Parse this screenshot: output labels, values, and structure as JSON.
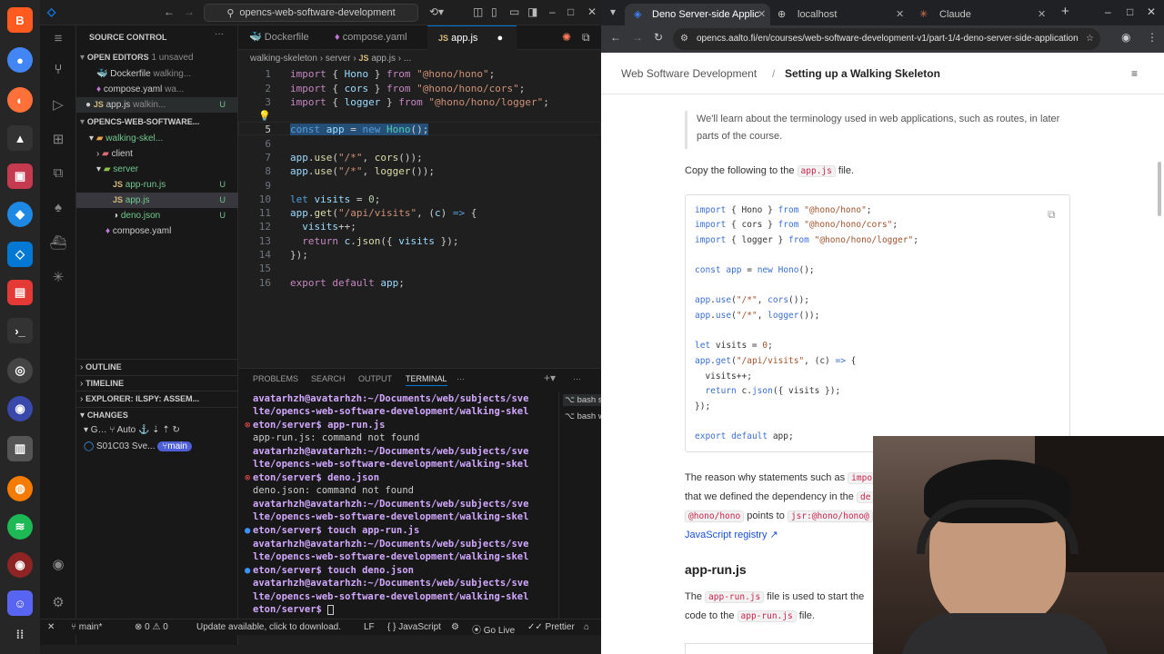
{
  "window": {
    "command_center": "opencs-web-software-development"
  },
  "sidebar": {
    "title": "SOURCE CONTROL",
    "open_editors": "OPEN EDITORS",
    "unsaved": "1 unsaved",
    "open_files": [
      {
        "name": "Dockerfile",
        "path": "walking...",
        "badge": ""
      },
      {
        "name": "compose.yaml",
        "path": "wa...",
        "badge": ""
      },
      {
        "name": "app.js",
        "path": "walkin...",
        "badge": "U"
      }
    ],
    "workspace": "OPENCS-WEB-SOFTWARE...",
    "tree": [
      {
        "name": "walking-skel...",
        "badge": ""
      },
      {
        "name": "client",
        "badge": ""
      },
      {
        "name": "server",
        "badge": ""
      },
      {
        "name": "app-run.js",
        "badge": "U"
      },
      {
        "name": "app.js",
        "badge": "U"
      },
      {
        "name": "deno.json",
        "badge": "U"
      },
      {
        "name": "compose.yaml",
        "badge": ""
      }
    ],
    "outline": "OUTLINE",
    "timeline": "TIMELINE",
    "explorer_ilspy": "EXPLORER: ILSPY: ASSEM...",
    "changes": "CHANGES",
    "repo_auto": "Auto",
    "repo": "S01C03 Sve...",
    "branch": "main"
  },
  "editor": {
    "tabs": [
      "Dockerfile",
      "compose.yaml",
      "app.js"
    ],
    "breadcrumbs": [
      "walking-skeleton",
      "server",
      "app.js",
      "..."
    ],
    "line_numbers": [
      "1",
      "2",
      "3",
      "4",
      "5",
      "6",
      "7",
      "8",
      "9",
      "10",
      "11",
      "12",
      "13",
      "14",
      "15",
      "16"
    ]
  },
  "panel": {
    "tabs": [
      "PROBLEMS",
      "SEARCH",
      "OUTPUT",
      "TERMINAL"
    ],
    "active": "TERMINAL",
    "terminals": [
      {
        "label": "bash se..."
      },
      {
        "label": "bash walkin..."
      }
    ],
    "lines": [
      "avatarhzh@avatarhzh:~/Documents/web/subjects/sve",
      "lte/opencs-web-software-development/walking-skel",
      "eton/server$ app-run.js",
      "app-run.js: command not found",
      "avatarhzh@avatarhzh:~/Documents/web/subjects/sve",
      "lte/opencs-web-software-development/walking-skel",
      "eton/server$ deno.json",
      "deno.json: command not found",
      "avatarhzh@avatarhzh:~/Documents/web/subjects/sve",
      "lte/opencs-web-software-development/walking-skel",
      "eton/server$ touch app-run.js",
      "avatarhzh@avatarhzh:~/Documents/web/subjects/sve",
      "lte/opencs-web-software-development/walking-skel",
      "eton/server$ touch deno.json",
      "avatarhzh@avatarhzh:~/Documents/web/subjects/sve",
      "lte/opencs-web-software-development/walking-skel",
      "eton/server$ "
    ]
  },
  "status": {
    "branch": "main*",
    "errors": "0",
    "warnings": "0",
    "update": "Update available, click to download.",
    "eol": "LF",
    "language": "JavaScript",
    "golive": "Go Live",
    "prettier": "Prettier"
  },
  "browser": {
    "tabs": [
      "Deno Server-side Applic",
      "localhost",
      "Claude"
    ],
    "url": "opencs.aalto.fi/en/courses/web-software-development-v1/part-1/4-deno-server-side-application",
    "breadcrumb_home": "Web Software Development",
    "breadcrumb_page": "Setting up a Walking Skeleton",
    "intro": "We'll learn about the terminology used in web applications, such as routes, in later parts of the course.",
    "copy_text_a": "Copy the following to the",
    "copy_file": "app.js",
    "copy_text_b": "file.",
    "para2_a": "The reason why statements such as",
    "para2_code": "impo",
    "para2_b": "that we defined the dependency in the",
    "para2_c": "de",
    "para2_code2": "@hono/hono",
    "para2_d": "points to",
    "para2_code3": "jsr:@hono/hono@",
    "para2_link": "JavaScript registry ↗",
    "section": "app-run.js",
    "para3_a": "The",
    "para3_code": "app-run.js",
    "para3_b": "file is used to start the",
    "para3_c": "code to the",
    "para3_code2": "app-run.js",
    "para3_d": "file."
  }
}
